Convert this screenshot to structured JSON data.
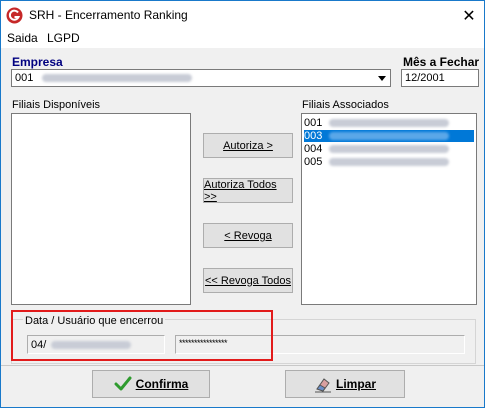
{
  "window": {
    "title": "SRH - Encerramento Ranking",
    "close_glyph": "✕"
  },
  "menu": {
    "items": [
      "Saida",
      "LGPD"
    ]
  },
  "empresa": {
    "label": "Empresa",
    "code": "001"
  },
  "mes": {
    "label": "Mês a Fechar",
    "value": "12/2001"
  },
  "filiais_disponiveis": {
    "label": "Filiais Disponíveis",
    "items": []
  },
  "filiais_associados": {
    "label": "Filiais Associados",
    "items": [
      {
        "code": "001",
        "selected": false
      },
      {
        "code": "003",
        "selected": true
      },
      {
        "code": "004",
        "selected": false
      },
      {
        "code": "005",
        "selected": false
      }
    ]
  },
  "buttons": {
    "autoriza": "Autoriza >",
    "autoriza_todos": "Autoriza Todos >>",
    "revoga": "< Revoga",
    "revoga_todos": "<< Revoga Todos"
  },
  "encerramento": {
    "group_label": "Data / Usuário que encerrou",
    "date_visible": "04/",
    "user_visible": "****************"
  },
  "footer": {
    "confirma": "Confirma",
    "limpar": "Limpar"
  },
  "colors": {
    "highlight": "#e21b1b",
    "selection": "#0078d7",
    "empresa_label": "#000080",
    "icon_red": "#c62828",
    "check_green": "#2e9b2e"
  },
  "icons": {
    "app": "app-logo-icon",
    "close": "close-icon",
    "dropdown": "chevron-down-icon",
    "confirma": "checkmark-icon",
    "limpar": "eraser-icon"
  }
}
